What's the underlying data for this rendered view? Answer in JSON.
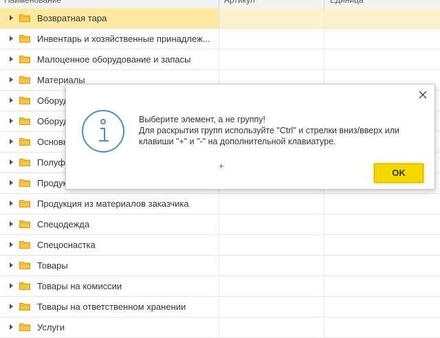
{
  "header": {
    "col_name": "Наименование",
    "col_article": "Артикул",
    "col_unit": "Единица"
  },
  "groups": [
    {
      "label": "Возвратная тара",
      "selected": true
    },
    {
      "label": "Инвентарь и хозяйственные принадлеж..."
    },
    {
      "label": "Малоценное оборудование и запасы"
    },
    {
      "label": "Материалы"
    },
    {
      "label": "Оборуд"
    },
    {
      "label": "Оборуд"
    },
    {
      "label": "Основн"
    },
    {
      "label": "Полуфа"
    },
    {
      "label": "Продук"
    },
    {
      "label": "Продукция из материалов заказчика"
    },
    {
      "label": "Спецодежда"
    },
    {
      "label": "Спецоснастка"
    },
    {
      "label": "Товары"
    },
    {
      "label": "Товары на комиссии"
    },
    {
      "label": "Товары на ответственном хранении"
    },
    {
      "label": "Услуги"
    }
  ],
  "dialog": {
    "line1": "Выберите элемент, а не группу!",
    "line2": "Для раскрытия групп используйте \"Ctrl\" и стрелки вниз/вверх или",
    "line3": "клавиши \"+\" и \"-\" на дополнительной клавиатуре.",
    "ok_label": "OK",
    "cursor_mark": "+"
  },
  "colors": {
    "selected_row": "#fde9a0",
    "ok_button": "#f5d800",
    "info_icon": "#4a8cc4",
    "folder": "#f6c544"
  }
}
